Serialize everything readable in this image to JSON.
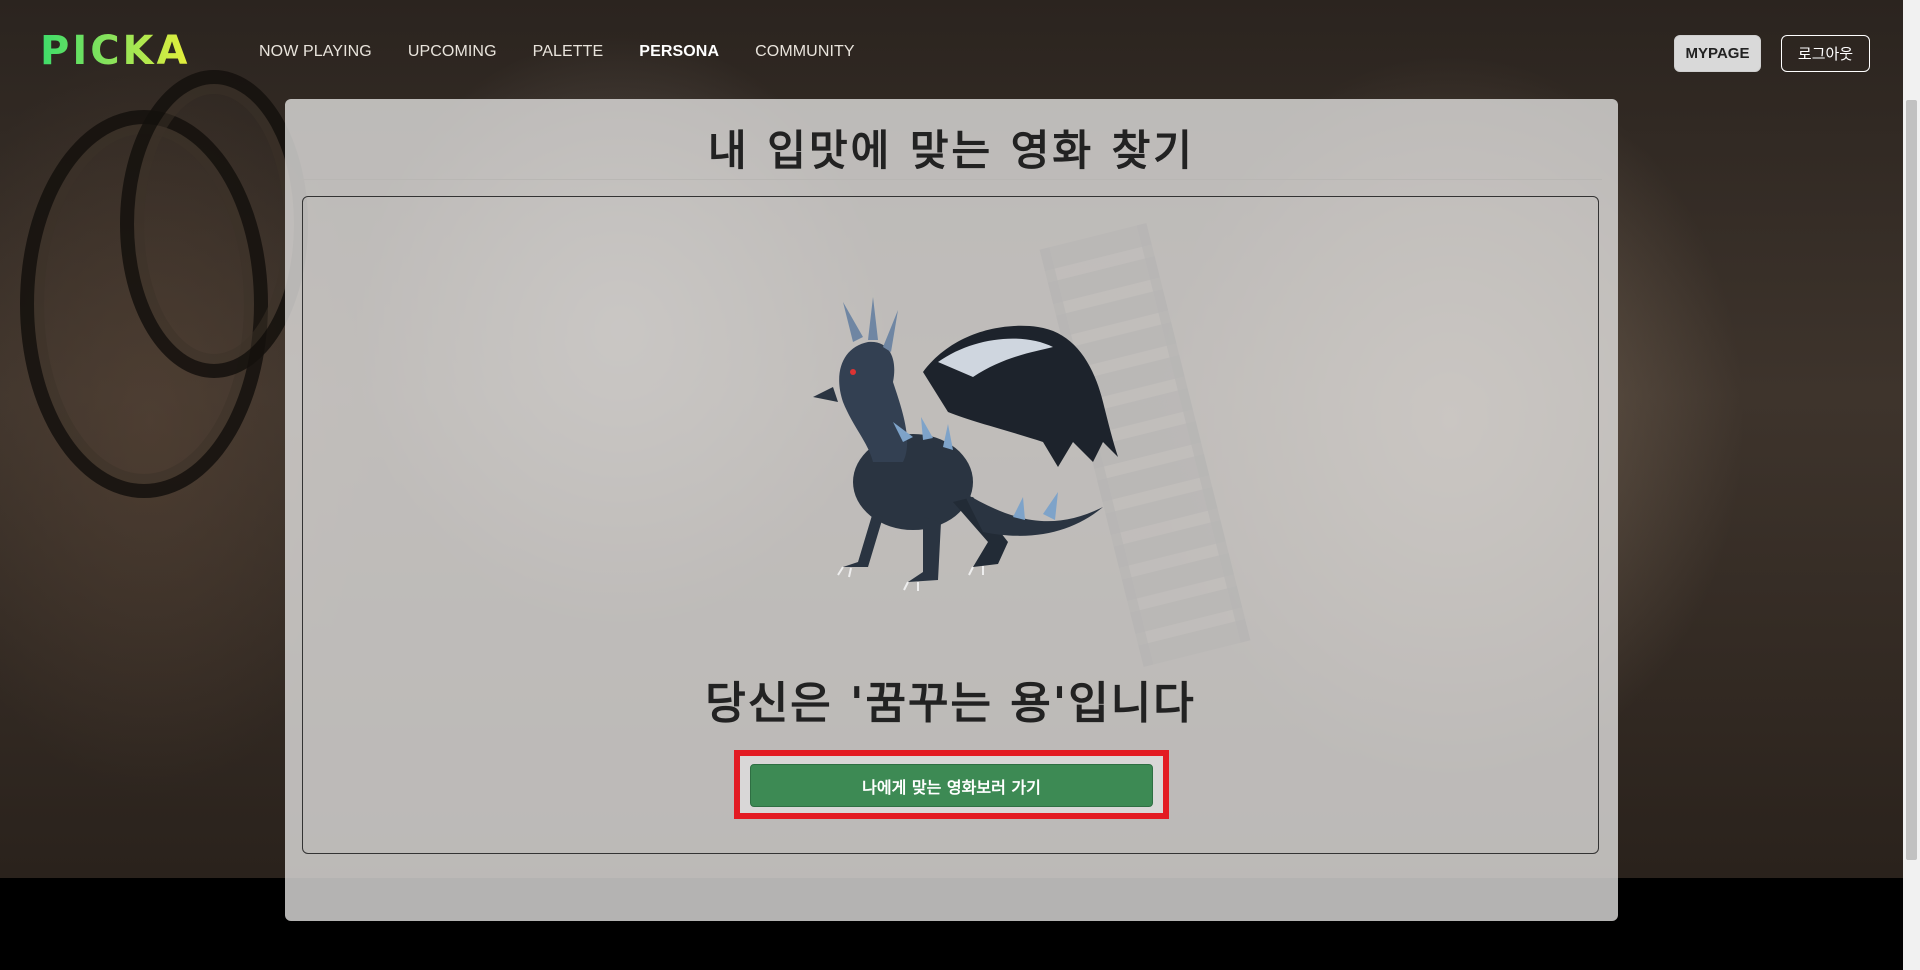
{
  "brand": {
    "logo": "PICKA"
  },
  "nav": {
    "links": [
      {
        "label": "NOW PLAYING",
        "active": false
      },
      {
        "label": "UPCOMING",
        "active": false
      },
      {
        "label": "PALETTE",
        "active": false
      },
      {
        "label": "PERSONA",
        "active": true
      },
      {
        "label": "COMMUNITY",
        "active": false
      }
    ],
    "mypage_label": "MYPAGE",
    "logout_label": "로그아웃"
  },
  "main": {
    "title": "내 입맛에 맞는 영화 찾기",
    "result": {
      "image_icon": "dragon-illustration",
      "text": "당신은 '꿈꾸는 용'입니다",
      "cta_label": "나에게 맞는 영화보러 가기"
    }
  },
  "colors": {
    "cta": "#3d8a54",
    "highlight": "#e31b23",
    "logo_gradient_start": "#3ddc6a",
    "logo_gradient_end": "#e8ef3a"
  }
}
